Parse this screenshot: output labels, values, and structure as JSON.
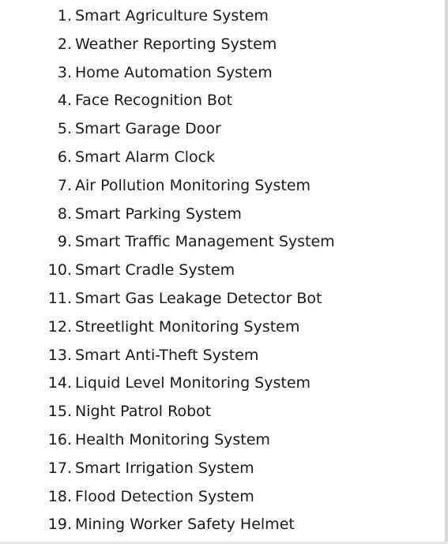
{
  "items": [
    {
      "number": "1.",
      "label": "Smart Agriculture System"
    },
    {
      "number": "2.",
      "label": "Weather Reporting System"
    },
    {
      "number": "3.",
      "label": "Home Automation System"
    },
    {
      "number": "4.",
      "label": "Face Recognition Bot"
    },
    {
      "number": "5.",
      "label": "Smart Garage Door"
    },
    {
      "number": "6.",
      "label": "Smart Alarm Clock"
    },
    {
      "number": "7.",
      "label": "Air Pollution Monitoring System"
    },
    {
      "number": "8.",
      "label": "Smart Parking System"
    },
    {
      "number": "9.",
      "label": "Smart Traffic Management System"
    },
    {
      "number": "10.",
      "label": "Smart Cradle System"
    },
    {
      "number": "11.",
      "label": "Smart Gas Leakage Detector Bot"
    },
    {
      "number": "12.",
      "label": "Streetlight Monitoring System"
    },
    {
      "number": "13.",
      "label": "Smart Anti-Theft System"
    },
    {
      "number": "14.",
      "label": "Liquid Level Monitoring System"
    },
    {
      "number": "15.",
      "label": "Night Patrol Robot"
    },
    {
      "number": "16.",
      "label": "Health Monitoring System"
    },
    {
      "number": "17.",
      "label": "Smart Irrigation System"
    },
    {
      "number": "18.",
      "label": "Flood Detection System"
    },
    {
      "number": "19.",
      "label": "Mining Worker Safety Helmet"
    }
  ]
}
